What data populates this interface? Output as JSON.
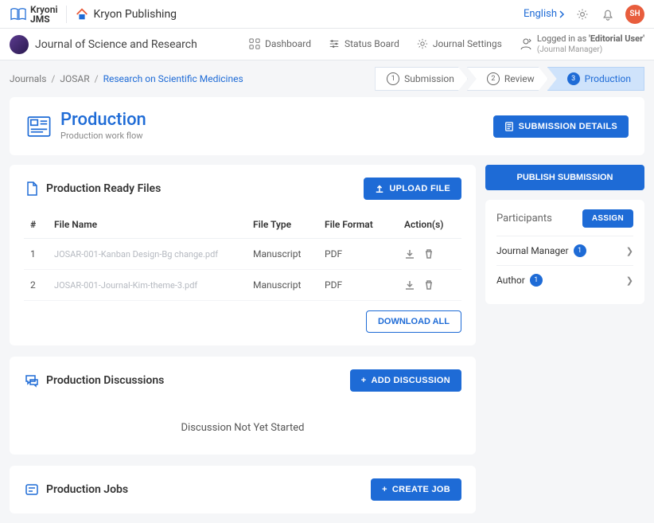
{
  "brand": {
    "name": "Kryoni",
    "sub": "JMS"
  },
  "app_name": "Kryon Publishing",
  "top": {
    "language": "English",
    "avatar_initials": "SH"
  },
  "subheader": {
    "journal_name": "Journal of Science and Research",
    "nav": [
      "Dashboard",
      "Status Board",
      "Journal Settings"
    ],
    "login_prefix": "Logged in as ",
    "login_user": "'Editorial User'",
    "login_role": "(Journal Manager)"
  },
  "breadcrumb": [
    "Journals",
    "JOSAR",
    "Research on Scientific Medicines"
  ],
  "stepper": [
    {
      "num": "1",
      "label": "Submission",
      "active": false
    },
    {
      "num": "2",
      "label": "Review",
      "active": false
    },
    {
      "num": "3",
      "label": "Production",
      "active": true
    }
  ],
  "page_title": {
    "title": "Production",
    "subtitle": "Production work flow"
  },
  "submission_details_btn": "Submission Details",
  "files_card": {
    "title": "Production Ready Files",
    "upload_btn": "Upload File",
    "download_all_btn": "Download All",
    "headers": {
      "num": "#",
      "name": "File Name",
      "type": "File Type",
      "format": "File Format",
      "actions": "Action(s)"
    },
    "rows": [
      {
        "num": "1",
        "name": "JOSAR-001-Kanban Design-Bg change.pdf",
        "type": "Manuscript",
        "format": "PDF"
      },
      {
        "num": "2",
        "name": "JOSAR-001-Journal-Kim-theme-3.pdf",
        "type": "Manuscript",
        "format": "PDF"
      }
    ]
  },
  "discussions": {
    "title": "Production Discussions",
    "add_btn": "Add Discussion",
    "empty": "Discussion Not Yet Started"
  },
  "jobs": {
    "title": "Production Jobs",
    "create_btn": "Create Job"
  },
  "side": {
    "publish_btn": "Publish Submission",
    "participants_title": "Participants",
    "assign_btn": "Assign",
    "participants": [
      {
        "role": "Journal Manager",
        "count": "1"
      },
      {
        "role": "Author",
        "count": "1"
      }
    ]
  }
}
